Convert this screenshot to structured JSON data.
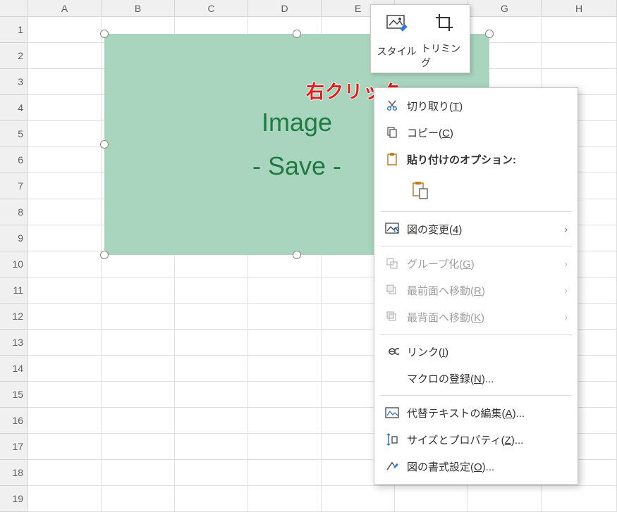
{
  "columns": [
    "A",
    "B",
    "C",
    "D",
    "E",
    "F",
    "G",
    "H"
  ],
  "rows": [
    "1",
    "2",
    "3",
    "4",
    "5",
    "6",
    "7",
    "8",
    "9",
    "10",
    "11",
    "12",
    "13",
    "14",
    "15",
    "16",
    "17",
    "18",
    "19"
  ],
  "image": {
    "line1": "Image",
    "line2": "- Save -",
    "fill": "#a9d5be",
    "text_color": "#1f7a43"
  },
  "annotation": "右クリック",
  "mini_toolbar": {
    "style": "スタイル",
    "trim": "トリミング"
  },
  "ctx": {
    "cut": {
      "label": "切り取り(",
      "hotkey": "T",
      "suffix": ")"
    },
    "copy": {
      "label": "コピー(",
      "hotkey": "C",
      "suffix": ")"
    },
    "paste_header": "貼り付けのオプション:",
    "change_pic": {
      "label": "図の変更(",
      "hotkey": "4",
      "suffix": ")"
    },
    "group": {
      "label": "グループ化(",
      "hotkey": "G",
      "suffix": ")"
    },
    "bring_front": {
      "label": "最前面へ移動(",
      "hotkey": "R",
      "suffix": ")"
    },
    "send_back": {
      "label": "最背面へ移動(",
      "hotkey": "K",
      "suffix": ")"
    },
    "link": {
      "label": "リンク(",
      "hotkey": "I",
      "suffix": ")"
    },
    "macro": {
      "label": "マクロの登録(",
      "hotkey": "N",
      "suffix": ")..."
    },
    "alt_text": {
      "label": "代替テキストの編集(",
      "hotkey": "A",
      "suffix": ")..."
    },
    "size_prop": {
      "label": "サイズとプロパティ(",
      "hotkey": "Z",
      "suffix": ")..."
    },
    "format_pic": {
      "label": "図の書式設定(",
      "hotkey": "O",
      "suffix": ")..."
    }
  }
}
